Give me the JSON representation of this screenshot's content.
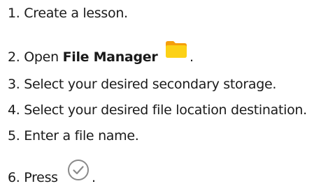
{
  "steps": [
    {
      "text": "1. Create a lesson."
    },
    {
      "prefix": "2. Open ",
      "bold": "File Manager",
      "suffix": ".",
      "icon": "folder-icon"
    },
    {
      "text": "3. Select your desired secondary storage."
    },
    {
      "text": "4. Select your desired file location destination."
    },
    {
      "text": "5. Enter a file name."
    },
    {
      "prefix": "6. Press ",
      "suffix": ".",
      "icon": "check-circle-icon"
    }
  ],
  "colors": {
    "folder_body": "#FCD116",
    "folder_tab": "#F59E0B",
    "check_stroke": "#8A8A8A",
    "text": "#1A1A1A"
  }
}
